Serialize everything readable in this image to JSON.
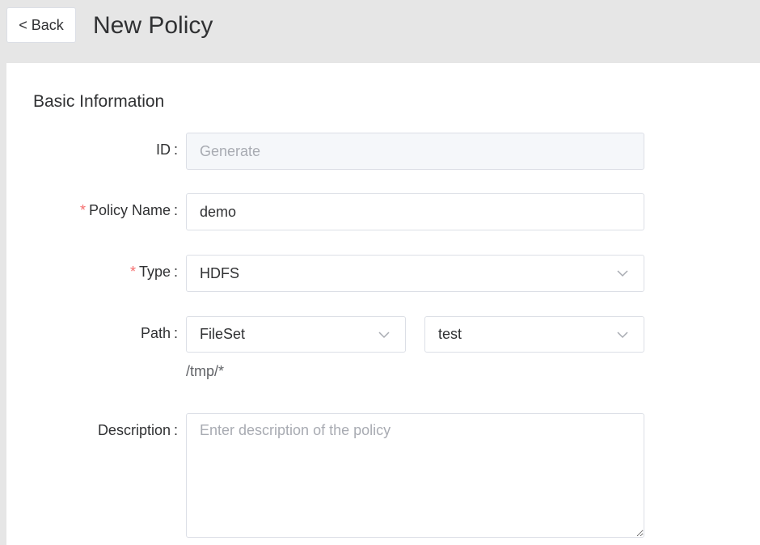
{
  "header": {
    "back_label": "< Back",
    "title": "New Policy"
  },
  "section": {
    "title": "Basic Information"
  },
  "form": {
    "id": {
      "label": "ID",
      "placeholder": "Generate"
    },
    "policy_name": {
      "label": "Policy Name",
      "required_mark": "*",
      "value": "demo"
    },
    "type": {
      "label": "Type",
      "required_mark": "*",
      "value": "HDFS"
    },
    "path": {
      "label": "Path",
      "select1": "FileSet",
      "select2": "test",
      "hint": "/tmp/*"
    },
    "description": {
      "label": "Description",
      "placeholder": "Enter description of the policy"
    },
    "colon": ":"
  },
  "colors": {
    "required": "#f56c6c",
    "border": "#dcdfe6",
    "placeholder": "#a8abb2"
  }
}
